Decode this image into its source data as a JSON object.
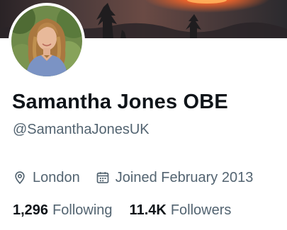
{
  "profile": {
    "display_name": "Samantha Jones OBE",
    "handle": "@SamanthaJonesUK",
    "location": "London",
    "joined": "Joined February 2013"
  },
  "stats": {
    "following_count": "1,296",
    "following_label": "Following",
    "followers_count": "11.4K",
    "followers_label": "Followers"
  },
  "icons": {
    "location": "location-pin-icon",
    "joined": "calendar-icon"
  },
  "colors": {
    "primary_text": "#0f1419",
    "secondary_text": "#536471",
    "background": "#ffffff"
  }
}
